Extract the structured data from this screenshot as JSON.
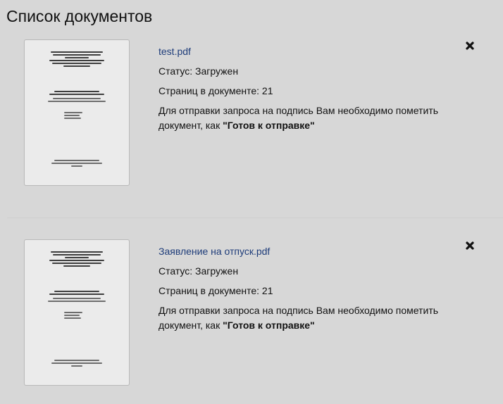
{
  "page": {
    "title": "Список документов"
  },
  "documents": [
    {
      "file_name": "test.pdf",
      "status": "Статус: Загружен",
      "pages": "Страниц в документе: 21",
      "note_text": "Для отправки запроса на подпись Вам необходимо пометить документ, как ",
      "note_highlight": "\"Готов к отправке\""
    },
    {
      "file_name": "Заявление на отпуск.pdf",
      "status": "Статус: Загружен",
      "pages": "Страниц в документе: 21",
      "note_text": "Для отправки запроса на подпись Вам необходимо пометить документ, как ",
      "note_highlight": "\"Готов к отправке\""
    }
  ],
  "icons": {
    "delete": "close-icon"
  },
  "colors": {
    "background": "#d7d7d7",
    "link": "#1f3d7a",
    "text": "#111111"
  }
}
